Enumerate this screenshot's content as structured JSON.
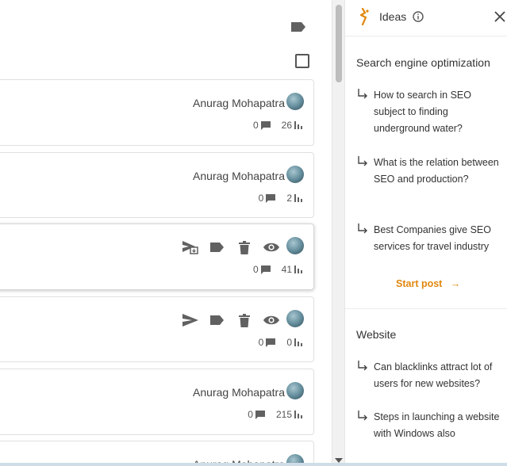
{
  "toolbar": {
    "label_icon": "label-icon",
    "select_all_icon": "checkbox-icon"
  },
  "posts": [
    {
      "author": "Anurag Mohapatra",
      "comments": "0",
      "views": "26",
      "mode": "author"
    },
    {
      "author": "Anurag Mohapatra",
      "comments": "0",
      "views": "2",
      "mode": "author"
    },
    {
      "author": "",
      "comments": "0",
      "views": "41",
      "mode": "actions",
      "first_action": "send-scheduled-icon"
    },
    {
      "author": "",
      "comments": "0",
      "views": "0",
      "mode": "actions",
      "first_action": "send-icon"
    },
    {
      "author": "Anurag Mohapatra",
      "comments": "0",
      "views": "215",
      "mode": "author"
    },
    {
      "author": "Anurag Mohapatra",
      "comments": "",
      "views": "",
      "mode": "author"
    }
  ],
  "ideas_panel": {
    "title": "Ideas",
    "start_post": "Start post",
    "sections": [
      {
        "title": "Search engine optimization",
        "items": [
          "How to search in SEO subject to finding underground water?",
          "What is the relation between SEO and production?",
          "Best Companies give SEO services for travel industry"
        ]
      },
      {
        "title": "Website",
        "items": [
          "Can blacklinks attract lot of users for new websites?",
          "Steps in launching a website with Windows also"
        ]
      }
    ]
  },
  "colors": {
    "accent": "#e0880f",
    "icon": "#616161",
    "border": "#e0e0e0"
  }
}
